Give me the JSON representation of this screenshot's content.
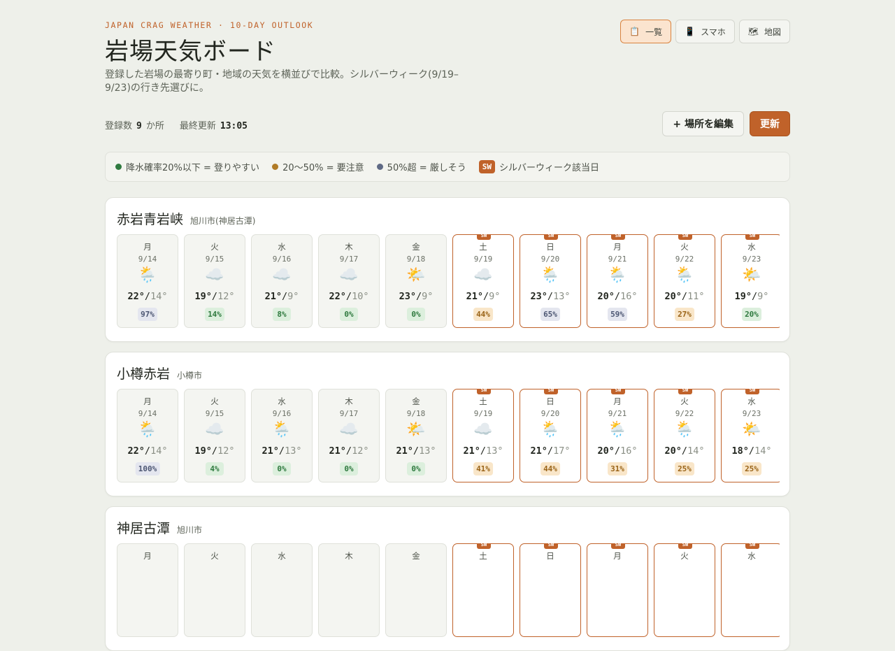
{
  "header": {
    "eyebrow": "JAPAN CRAG WEATHER · 10-DAY OUTLOOK",
    "title": "岩場天気ボード",
    "subtitle": "登録した岩場の最寄り町・地域の天気を横並びで比較。シルバーウィーク(9/19–9/23)の行き先選びに。"
  },
  "views": [
    {
      "icon": "📋",
      "label": "一覧",
      "active": true
    },
    {
      "icon": "📱",
      "label": "スマホ",
      "active": false
    },
    {
      "icon": "🗺",
      "label": "地図",
      "active": false
    }
  ],
  "stats": {
    "count_label": "登録数",
    "count_value": "9",
    "count_unit": "か所",
    "updated_label": "最終更新",
    "updated_value": "13:05"
  },
  "actions": {
    "edit_label": "+ 場所を編集",
    "refresh_label": "更新"
  },
  "legend": {
    "low": "降水確率20%以下 = 登りやすい",
    "mid": "20〜50% = 要注意",
    "high": "50%超 = 厳しそう",
    "sw_tag": "SW",
    "sw_text": "シルバーウィーク該当日"
  },
  "colors": {
    "accent": "#c0622a",
    "low": "#2f7a3f",
    "mid": "#b07b26",
    "high": "#5f6a85"
  },
  "crags": [
    {
      "name": "赤岩青岩峡",
      "location": "旭川市(神居古潭)",
      "days": [
        {
          "dow": "月",
          "date": "9/14",
          "icon": "🌦️",
          "hi": "22°",
          "lo": "14°",
          "pop": "97%",
          "level": "high",
          "sw": false
        },
        {
          "dow": "火",
          "date": "9/15",
          "icon": "☁️",
          "hi": "19°",
          "lo": "12°",
          "pop": "14%",
          "level": "low",
          "sw": false
        },
        {
          "dow": "水",
          "date": "9/16",
          "icon": "☁️",
          "hi": "21°",
          "lo": "9°",
          "pop": "8%",
          "level": "low",
          "sw": false
        },
        {
          "dow": "木",
          "date": "9/17",
          "icon": "☁️",
          "hi": "22°",
          "lo": "10°",
          "pop": "0%",
          "level": "low",
          "sw": false
        },
        {
          "dow": "金",
          "date": "9/18",
          "icon": "🌤️",
          "hi": "23°",
          "lo": "9°",
          "pop": "0%",
          "level": "low",
          "sw": false
        },
        {
          "dow": "土",
          "date": "9/19",
          "icon": "☁️",
          "hi": "21°",
          "lo": "9°",
          "pop": "44%",
          "level": "mid",
          "sw": true
        },
        {
          "dow": "日",
          "date": "9/20",
          "icon": "🌦️",
          "hi": "23°",
          "lo": "13°",
          "pop": "65%",
          "level": "high",
          "sw": true
        },
        {
          "dow": "月",
          "date": "9/21",
          "icon": "🌦️",
          "hi": "20°",
          "lo": "16°",
          "pop": "59%",
          "level": "high",
          "sw": true
        },
        {
          "dow": "火",
          "date": "9/22",
          "icon": "🌦️",
          "hi": "20°",
          "lo": "11°",
          "pop": "27%",
          "level": "mid",
          "sw": true
        },
        {
          "dow": "水",
          "date": "9/23",
          "icon": "🌤️",
          "hi": "19°",
          "lo": "9°",
          "pop": "20%",
          "level": "low",
          "sw": true
        }
      ]
    },
    {
      "name": "小樽赤岩",
      "location": "小樽市",
      "days": [
        {
          "dow": "月",
          "date": "9/14",
          "icon": "🌦️",
          "hi": "22°",
          "lo": "14°",
          "pop": "100%",
          "level": "high",
          "sw": false
        },
        {
          "dow": "火",
          "date": "9/15",
          "icon": "☁️",
          "hi": "19°",
          "lo": "12°",
          "pop": "4%",
          "level": "low",
          "sw": false
        },
        {
          "dow": "水",
          "date": "9/16",
          "icon": "🌦️",
          "hi": "21°",
          "lo": "13°",
          "pop": "0%",
          "level": "low",
          "sw": false
        },
        {
          "dow": "木",
          "date": "9/17",
          "icon": "☁️",
          "hi": "21°",
          "lo": "12°",
          "pop": "0%",
          "level": "low",
          "sw": false
        },
        {
          "dow": "金",
          "date": "9/18",
          "icon": "🌤️",
          "hi": "21°",
          "lo": "13°",
          "pop": "0%",
          "level": "low",
          "sw": false
        },
        {
          "dow": "土",
          "date": "9/19",
          "icon": "☁️",
          "hi": "21°",
          "lo": "13°",
          "pop": "41%",
          "level": "mid",
          "sw": true
        },
        {
          "dow": "日",
          "date": "9/20",
          "icon": "🌦️",
          "hi": "21°",
          "lo": "17°",
          "pop": "44%",
          "level": "mid",
          "sw": true
        },
        {
          "dow": "月",
          "date": "9/21",
          "icon": "🌦️",
          "hi": "20°",
          "lo": "16°",
          "pop": "31%",
          "level": "mid",
          "sw": true
        },
        {
          "dow": "火",
          "date": "9/22",
          "icon": "🌦️",
          "hi": "20°",
          "lo": "14°",
          "pop": "25%",
          "level": "mid",
          "sw": true
        },
        {
          "dow": "水",
          "date": "9/23",
          "icon": "🌤️",
          "hi": "18°",
          "lo": "14°",
          "pop": "25%",
          "level": "mid",
          "sw": true
        }
      ]
    },
    {
      "name": "神居古潭",
      "location": "旭川市",
      "days": [
        {
          "dow": "月",
          "date": "",
          "icon": "",
          "hi": "",
          "lo": "",
          "pop": "",
          "level": "",
          "sw": false
        },
        {
          "dow": "火",
          "date": "",
          "icon": "",
          "hi": "",
          "lo": "",
          "pop": "",
          "level": "",
          "sw": false
        },
        {
          "dow": "水",
          "date": "",
          "icon": "",
          "hi": "",
          "lo": "",
          "pop": "",
          "level": "",
          "sw": false
        },
        {
          "dow": "木",
          "date": "",
          "icon": "",
          "hi": "",
          "lo": "",
          "pop": "",
          "level": "",
          "sw": false
        },
        {
          "dow": "金",
          "date": "",
          "icon": "",
          "hi": "",
          "lo": "",
          "pop": "",
          "level": "",
          "sw": false
        },
        {
          "dow": "土",
          "date": "",
          "icon": "",
          "hi": "",
          "lo": "",
          "pop": "",
          "level": "",
          "sw": true
        },
        {
          "dow": "日",
          "date": "",
          "icon": "",
          "hi": "",
          "lo": "",
          "pop": "",
          "level": "",
          "sw": true
        },
        {
          "dow": "月",
          "date": "",
          "icon": "",
          "hi": "",
          "lo": "",
          "pop": "",
          "level": "",
          "sw": true
        },
        {
          "dow": "火",
          "date": "",
          "icon": "",
          "hi": "",
          "lo": "",
          "pop": "",
          "level": "",
          "sw": true
        },
        {
          "dow": "水",
          "date": "",
          "icon": "",
          "hi": "",
          "lo": "",
          "pop": "",
          "level": "",
          "sw": true
        }
      ]
    }
  ]
}
